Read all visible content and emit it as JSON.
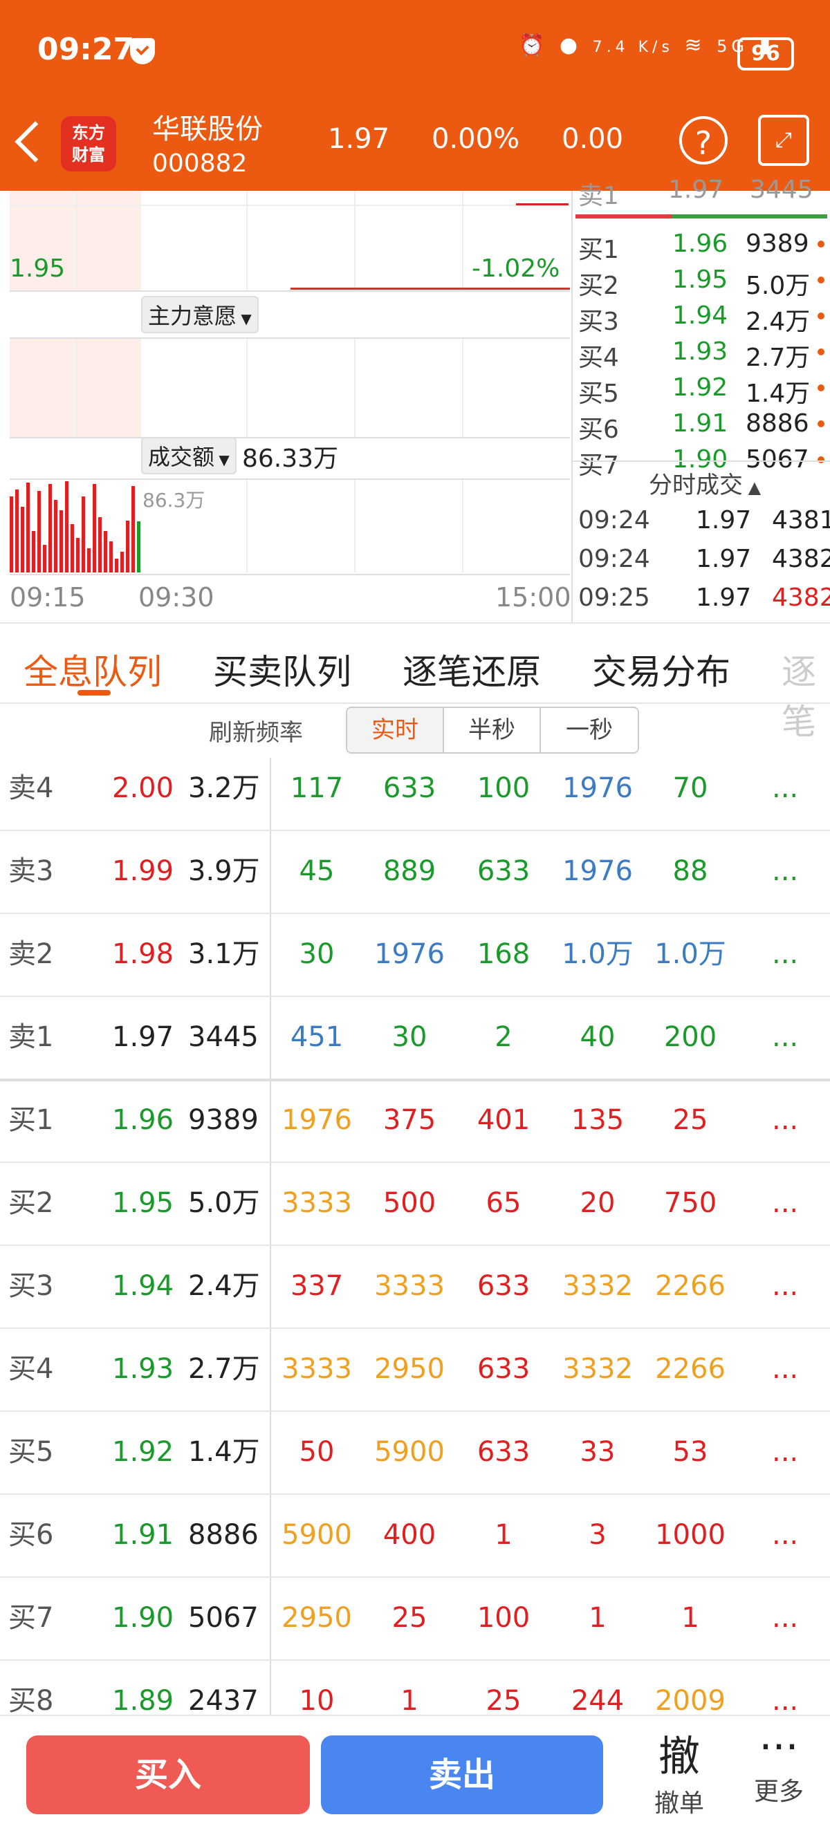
{
  "status": {
    "time": "09:27",
    "net_speed": "7.4 K/s",
    "network": "5G",
    "battery": "96"
  },
  "header": {
    "logo_line1": "东方",
    "logo_line2": "财富",
    "name": "华联股份",
    "code": "000882",
    "price": "1.97",
    "change_pct": "0.00%",
    "change": "0.00",
    "help_icon": "?"
  },
  "chart": {
    "price_low_label": "1.95",
    "pct_low_label": "-1.02%",
    "indicator1": "主力意愿",
    "indicator2": "成交额",
    "amount": "86.33万",
    "vol_label": "86.3万",
    "times": [
      "09:15",
      "09:30",
      "15:00"
    ]
  },
  "orderbook": {
    "top_partial": {
      "label": "卖1",
      "price": "1.97",
      "vol": "3445"
    },
    "bids": [
      {
        "label": "买1",
        "price": "1.96",
        "vol": "9389"
      },
      {
        "label": "买2",
        "price": "1.95",
        "vol": "5.0万"
      },
      {
        "label": "买3",
        "price": "1.94",
        "vol": "2.4万"
      },
      {
        "label": "买4",
        "price": "1.93",
        "vol": "2.7万"
      },
      {
        "label": "买5",
        "price": "1.92",
        "vol": "1.4万"
      },
      {
        "label": "买6",
        "price": "1.91",
        "vol": "8886"
      },
      {
        "label": "买7",
        "price": "1.90",
        "vol": "5067"
      }
    ],
    "ticks_title": "分时成交",
    "ticks": [
      {
        "time": "09:24",
        "price": "1.97",
        "vol": "4381"
      },
      {
        "time": "09:24",
        "price": "1.97",
        "vol": "4382"
      },
      {
        "time": "09:25",
        "price": "1.97",
        "vol": "4382"
      }
    ]
  },
  "tabs": [
    "全息队列",
    "买卖队列",
    "逐笔还原",
    "交易分布",
    "逐笔"
  ],
  "refresh": {
    "label": "刷新频率",
    "options": [
      "实时",
      "半秒",
      "一秒"
    ],
    "selected": "实时"
  },
  "queue": [
    {
      "label": "卖4",
      "price": "2.00",
      "vol": "3.2万",
      "orders": [
        "117",
        "633",
        "100",
        "1976",
        "70"
      ],
      "more": "..."
    },
    {
      "label": "卖3",
      "price": "1.99",
      "vol": "3.9万",
      "orders": [
        "45",
        "889",
        "633",
        "1976",
        "88"
      ],
      "more": "..."
    },
    {
      "label": "卖2",
      "price": "1.98",
      "vol": "3.1万",
      "orders": [
        "30",
        "1976",
        "168",
        "1.0万",
        "1.0万"
      ],
      "more": "..."
    },
    {
      "label": "卖1",
      "price": "1.97",
      "vol": "3445",
      "orders": [
        "451",
        "30",
        "2",
        "40",
        "200"
      ],
      "more": "..."
    },
    {
      "label": "买1",
      "price": "1.96",
      "vol": "9389",
      "orders": [
        "1976",
        "375",
        "401",
        "135",
        "25"
      ],
      "more": "..."
    },
    {
      "label": "买2",
      "price": "1.95",
      "vol": "5.0万",
      "orders": [
        "3333",
        "500",
        "65",
        "20",
        "750"
      ],
      "more": "..."
    },
    {
      "label": "买3",
      "price": "1.94",
      "vol": "2.4万",
      "orders": [
        "337",
        "3333",
        "633",
        "3332",
        "2266"
      ],
      "more": "..."
    },
    {
      "label": "买4",
      "price": "1.93",
      "vol": "2.7万",
      "orders": [
        "3333",
        "2950",
        "633",
        "3332",
        "2266"
      ],
      "more": "..."
    },
    {
      "label": "买5",
      "price": "1.92",
      "vol": "1.4万",
      "orders": [
        "50",
        "5900",
        "633",
        "33",
        "53"
      ],
      "more": "..."
    },
    {
      "label": "买6",
      "price": "1.91",
      "vol": "8886",
      "orders": [
        "5900",
        "400",
        "1",
        "3",
        "1000"
      ],
      "more": "..."
    },
    {
      "label": "买7",
      "price": "1.90",
      "vol": "5067",
      "orders": [
        "2950",
        "25",
        "100",
        "1",
        "1"
      ],
      "more": "..."
    },
    {
      "label": "买8",
      "price": "1.89",
      "vol": "2437",
      "orders": [
        "10",
        "1",
        "25",
        "244",
        "2009"
      ],
      "more": "..."
    }
  ],
  "colors": {
    "accent": "#ec5a12",
    "up": "#e02020",
    "down": "#1a9a2a",
    "blue": "#3b7bc2",
    "orange": "#f0a020",
    "black": "#222222"
  },
  "bottom": {
    "buy": "买入",
    "sell": "卖出",
    "cancel_icon": "撤",
    "cancel": "撤单",
    "more_icon": "···",
    "more": "更多"
  }
}
